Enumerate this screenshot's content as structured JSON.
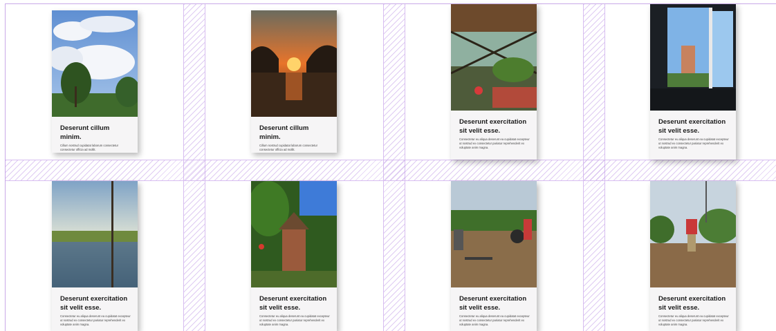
{
  "cards": [
    {
      "title": "Deserunt cillum minim.",
      "text": "Cillum nostrud cupidatat laborum consectetur consectetur officia ad mollit."
    },
    {
      "title": "Deserunt cillum minim.",
      "text": "Cillum nostrud cupidatat laborum consectetur consectetur officia ad mollit."
    },
    {
      "title": "Deserunt exercitation sit velit esse.",
      "text": "Consectetur eu aliqua deserunt ea cupidatat excepteur ut nostrud ex consectetur pariatur reprehenderit ex voluptate anim magna."
    },
    {
      "title": "Deserunt exercitation sit velit esse.",
      "text": "Consectetur eu aliqua deserunt ea cupidatat excepteur ut nostrud ex consectetur pariatur reprehenderit ex voluptate anim magna."
    },
    {
      "title": "Deserunt exercitation sit velit esse.",
      "text": "Consectetur eu aliqua deserunt ea cupidatat excepteur ut nostrud ex consectetur pariatur reprehenderit ex voluptate anim magna."
    },
    {
      "title": "Deserunt exercitation sit velit esse.",
      "text": "Consectetur eu aliqua deserunt ea cupidatat excepteur ut nostrud ex consectetur pariatur reprehenderit ex voluptate anim magna."
    },
    {
      "title": "Deserunt exercitation sit velit esse.",
      "text": "Consectetur eu aliqua deserunt ea cupidatat excepteur ut nostrud ex consectetur pariatur reprehenderit ex voluptate anim magna."
    },
    {
      "title": "Deserunt exercitation sit velit esse.",
      "text": "Consectetur eu aliqua deserunt ea cupidatat excepteur ut nostrud ex consectetur pariatur reprehenderit ex voluptate anim magna."
    }
  ],
  "colors": {
    "grid_guide": "#c9a8e8",
    "card_bg": "#f6f5f6",
    "title": "#1b1b1b"
  }
}
